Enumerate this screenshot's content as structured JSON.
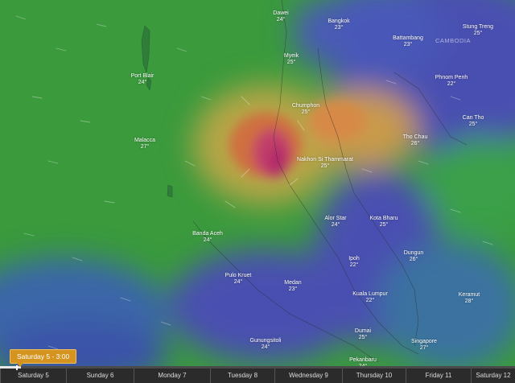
{
  "map": {
    "country_labels": [
      "CAMBODIA"
    ],
    "cities": [
      {
        "name": "Dawei",
        "temp": "24°"
      },
      {
        "name": "Bangkok",
        "temp": "23°"
      },
      {
        "name": "Stung Treng",
        "temp": "25°"
      },
      {
        "name": "Battambang",
        "temp": "23°"
      },
      {
        "name": "Myeik",
        "temp": "25°"
      },
      {
        "name": "Port Blair",
        "temp": "24°"
      },
      {
        "name": "Phnom Penh",
        "temp": "22°"
      },
      {
        "name": "Chumphon",
        "temp": "25°"
      },
      {
        "name": "Can Tho",
        "temp": "25°"
      },
      {
        "name": "Malacca",
        "temp": "27°"
      },
      {
        "name": "Tho Chau",
        "temp": "26°"
      },
      {
        "name": "Nakhon Si Thammarat",
        "temp": "25°"
      },
      {
        "name": "Alor Star",
        "temp": "24°"
      },
      {
        "name": "Kota Bharu",
        "temp": "25°"
      },
      {
        "name": "Banda Aceh",
        "temp": "24°"
      },
      {
        "name": "Ipoh",
        "temp": "22°"
      },
      {
        "name": "Dungun",
        "temp": "26°"
      },
      {
        "name": "Pulo Kruet",
        "temp": "24°"
      },
      {
        "name": "Medan",
        "temp": "23°"
      },
      {
        "name": "Kuala Lumpur",
        "temp": "22°"
      },
      {
        "name": "Keramut",
        "temp": "28°"
      },
      {
        "name": "Dumai",
        "temp": "25°"
      },
      {
        "name": "Gunungsitoli",
        "temp": "24°"
      },
      {
        "name": "Singapore",
        "temp": "27°"
      },
      {
        "name": "Pekanbaru",
        "temp": "24°"
      }
    ]
  },
  "timeline": {
    "current_label": "Saturday 5 - 3:00",
    "progress": 0.04,
    "days": [
      "Saturday 5",
      "Sunday 6",
      "Monday 7",
      "Tuesday 8",
      "Wednesday 9",
      "Thursday 10",
      "Friday 11",
      "Saturday 12"
    ]
  },
  "colors": {
    "calm": "#2e8f3a",
    "moderate": "#b9a84a",
    "strong": "#d06a3c",
    "extreme": "#c0306a",
    "low": "#3b4bb0"
  }
}
